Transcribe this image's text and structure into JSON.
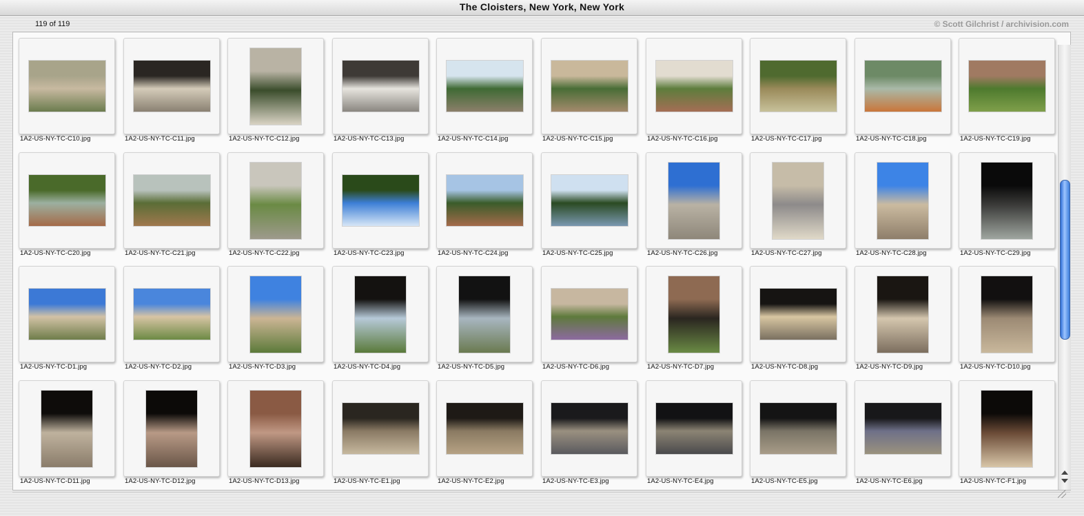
{
  "window": {
    "title": "The Cloisters, New York, New York"
  },
  "info": {
    "count": "119 of 119",
    "credit": "© Scott Gilchrist / archivision.com"
  },
  "thumbnails": [
    {
      "file": "1A2-US-NY-TC-C10.jpg",
      "orientation": "landscape",
      "colors": [
        "#a8a48a",
        "#c7b9a0",
        "#6b7c4e"
      ]
    },
    {
      "file": "1A2-US-NY-TC-C11.jpg",
      "orientation": "landscape",
      "colors": [
        "#2a2622",
        "#d4cbb9",
        "#8a8172"
      ]
    },
    {
      "file": "1A2-US-NY-TC-C12.jpg",
      "orientation": "portrait",
      "colors": [
        "#b9b3a4",
        "#3b4d2c",
        "#d9d3c4"
      ]
    },
    {
      "file": "1A2-US-NY-TC-C13.jpg",
      "orientation": "landscape",
      "colors": [
        "#3e3a36",
        "#e6e4de",
        "#8a8680"
      ]
    },
    {
      "file": "1A2-US-NY-TC-C14.jpg",
      "orientation": "landscape",
      "colors": [
        "#d6e4ee",
        "#3f6a34",
        "#8c7f6a"
      ]
    },
    {
      "file": "1A2-US-NY-TC-C15.jpg",
      "orientation": "landscape",
      "colors": [
        "#c9b89b",
        "#496d36",
        "#a48a6c"
      ]
    },
    {
      "file": "1A2-US-NY-TC-C16.jpg",
      "orientation": "landscape",
      "colors": [
        "#e2dcd0",
        "#5d7d3c",
        "#a56e55"
      ]
    },
    {
      "file": "1A2-US-NY-TC-C17.jpg",
      "orientation": "landscape",
      "colors": [
        "#4f6a2f",
        "#9a8a5a",
        "#c7c19a"
      ]
    },
    {
      "file": "1A2-US-NY-TC-C18.jpg",
      "orientation": "landscape",
      "colors": [
        "#6d8a66",
        "#a9b9a8",
        "#c9763a"
      ]
    },
    {
      "file": "1A2-US-NY-TC-C19.jpg",
      "orientation": "landscape",
      "colors": [
        "#a07a62",
        "#4e7a2e",
        "#7f9f4a"
      ]
    },
    {
      "file": "1A2-US-NY-TC-C20.jpg",
      "orientation": "landscape",
      "colors": [
        "#4a6a2a",
        "#9cb0a0",
        "#a46a48"
      ]
    },
    {
      "file": "1A2-US-NY-TC-C21.jpg",
      "orientation": "landscape",
      "colors": [
        "#b8c2bc",
        "#5a6d36",
        "#a0784e"
      ]
    },
    {
      "file": "1A2-US-NY-TC-C22.jpg",
      "orientation": "portrait",
      "colors": [
        "#c9c6bc",
        "#6a8a44",
        "#9e9a8c"
      ]
    },
    {
      "file": "1A2-US-NY-TC-C23.jpg",
      "orientation": "landscape",
      "colors": [
        "#2a4a1a",
        "#3d7fd6",
        "#d6e6f6"
      ]
    },
    {
      "file": "1A2-US-NY-TC-C24.jpg",
      "orientation": "landscape",
      "colors": [
        "#a6c4e4",
        "#3a5c2a",
        "#a46a4a"
      ]
    },
    {
      "file": "1A2-US-NY-TC-C25.jpg",
      "orientation": "landscape",
      "colors": [
        "#cfe0f0",
        "#2a4a22",
        "#7a98b0"
      ]
    },
    {
      "file": "1A2-US-NY-TC-C26.jpg",
      "orientation": "portrait",
      "colors": [
        "#2e6fd2",
        "#b9b2a4",
        "#8e877a"
      ]
    },
    {
      "file": "1A2-US-NY-TC-C27.jpg",
      "orientation": "portrait",
      "colors": [
        "#c6bca8",
        "#8d8a8a",
        "#e0d9c8"
      ]
    },
    {
      "file": "1A2-US-NY-TC-C28.jpg",
      "orientation": "portrait",
      "colors": [
        "#3d84e6",
        "#cbbba0",
        "#8e7e6a"
      ]
    },
    {
      "file": "1A2-US-NY-TC-C29.jpg",
      "orientation": "portrait",
      "colors": [
        "#0a0a0a",
        "#3a3a38",
        "#9fa6a0"
      ]
    },
    {
      "file": "1A2-US-NY-TC-D1.jpg",
      "orientation": "landscape",
      "colors": [
        "#3c79d6",
        "#d2c2a6",
        "#6e7d4a"
      ]
    },
    {
      "file": "1A2-US-NY-TC-D2.jpg",
      "orientation": "landscape",
      "colors": [
        "#4a86dc",
        "#d7c4a4",
        "#6c8a44"
      ]
    },
    {
      "file": "1A2-US-NY-TC-D3.jpg",
      "orientation": "portrait",
      "colors": [
        "#3f82e0",
        "#cbb594",
        "#5c7a3a"
      ]
    },
    {
      "file": "1A2-US-NY-TC-D4.jpg",
      "orientation": "portrait",
      "colors": [
        "#141210",
        "#b6c9d8",
        "#5a7a3a"
      ]
    },
    {
      "file": "1A2-US-NY-TC-D5.jpg",
      "orientation": "portrait",
      "colors": [
        "#121212",
        "#a8b6c0",
        "#6a7a50"
      ]
    },
    {
      "file": "1A2-US-NY-TC-D6.jpg",
      "orientation": "landscape",
      "colors": [
        "#c7b7a0",
        "#5e7a3c",
        "#8c6aa0"
      ]
    },
    {
      "file": "1A2-US-NY-TC-D7.jpg",
      "orientation": "portrait",
      "colors": [
        "#8e6a52",
        "#2a2620",
        "#6a8a44"
      ]
    },
    {
      "file": "1A2-US-NY-TC-D8.jpg",
      "orientation": "landscape",
      "colors": [
        "#161412",
        "#d8c6a2",
        "#7a7060"
      ]
    },
    {
      "file": "1A2-US-NY-TC-D9.jpg",
      "orientation": "portrait",
      "colors": [
        "#1a1612",
        "#d4c6ae",
        "#7c6e5e"
      ]
    },
    {
      "file": "1A2-US-NY-TC-D10.jpg",
      "orientation": "portrait",
      "colors": [
        "#121010",
        "#9c8a74",
        "#c9b89c"
      ]
    },
    {
      "file": "1A2-US-NY-TC-D11.jpg",
      "orientation": "portrait",
      "colors": [
        "#0e0c0a",
        "#bfb29e",
        "#8a7c6a"
      ]
    },
    {
      "file": "1A2-US-NY-TC-D12.jpg",
      "orientation": "portrait",
      "colors": [
        "#0c0a08",
        "#b89a86",
        "#6a5648"
      ]
    },
    {
      "file": "1A2-US-NY-TC-D13.jpg",
      "orientation": "portrait",
      "colors": [
        "#8a5a44",
        "#c09884",
        "#3a2a20"
      ]
    },
    {
      "file": "1A2-US-NY-TC-E1.jpg",
      "orientation": "landscape",
      "colors": [
        "#2a2620",
        "#8a7a64",
        "#c6b89e"
      ]
    },
    {
      "file": "1A2-US-NY-TC-E2.jpg",
      "orientation": "landscape",
      "colors": [
        "#1e1a16",
        "#8a7a62",
        "#b6a284"
      ]
    },
    {
      "file": "1A2-US-NY-TC-E3.jpg",
      "orientation": "landscape",
      "colors": [
        "#1a1a1c",
        "#9a9080",
        "#5a5a5e"
      ]
    },
    {
      "file": "1A2-US-NY-TC-E4.jpg",
      "orientation": "landscape",
      "colors": [
        "#121214",
        "#8c8474",
        "#4a4a4c"
      ]
    },
    {
      "file": "1A2-US-NY-TC-E5.jpg",
      "orientation": "landscape",
      "colors": [
        "#141414",
        "#7a7466",
        "#a89c88"
      ]
    },
    {
      "file": "1A2-US-NY-TC-E6.jpg",
      "orientation": "landscape",
      "colors": [
        "#18181a",
        "#6e7088",
        "#9a927e"
      ]
    },
    {
      "file": "1A2-US-NY-TC-F1.jpg",
      "orientation": "portrait",
      "colors": [
        "#0c0a08",
        "#6a4a36",
        "#d8c6a8"
      ]
    }
  ]
}
